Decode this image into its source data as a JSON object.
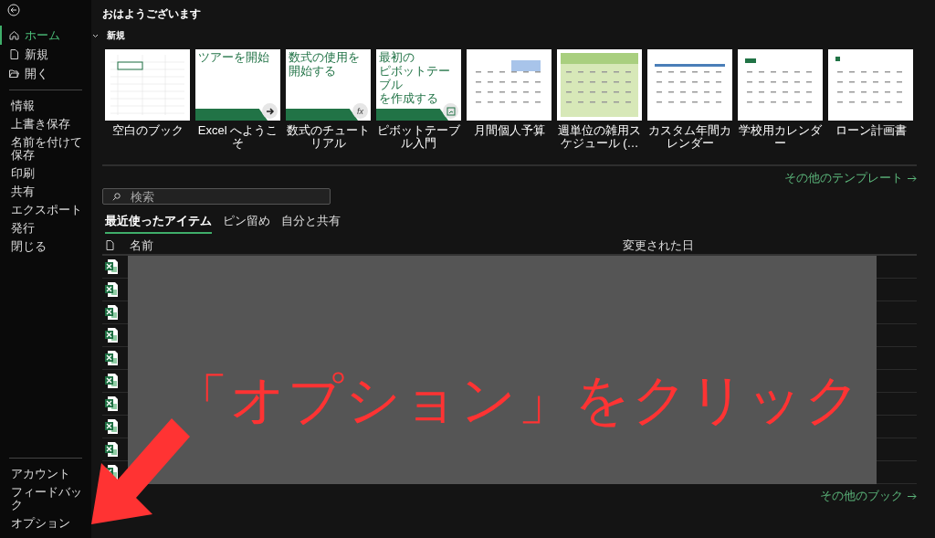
{
  "sidebar": {
    "primary_items": [
      {
        "label": "ホーム",
        "kind": "home",
        "selected": true
      },
      {
        "label": "新規",
        "kind": "new",
        "selected": false
      },
      {
        "label": "開く",
        "kind": "open",
        "selected": false
      }
    ],
    "items": [
      "情報",
      "上書き保存",
      "名前を付けて保存",
      "印刷",
      "共有",
      "エクスポート",
      "発行",
      "閉じる"
    ],
    "bottom_items": [
      "アカウント",
      "フィードバック",
      "オプション"
    ]
  },
  "greeting": "おはようございます",
  "new_section": {
    "title": "新規",
    "expanded": true,
    "templates": [
      {
        "kind": "blank",
        "label": "空白のブック"
      },
      {
        "kind": "tour",
        "label": "Excel へようこそ",
        "lines": [
          "ツアーを開始"
        ]
      },
      {
        "kind": "formula",
        "label": "数式のチュートリアル",
        "lines": [
          "数式の使用を",
          "開始する"
        ],
        "badge": "fx"
      },
      {
        "kind": "pivot",
        "label": "ピボットテーブル入門",
        "lines": [
          "最初の",
          "ピボットテーブル",
          "を作成する"
        ]
      },
      {
        "kind": "budget",
        "label": "月間個人予算"
      },
      {
        "kind": "schedule",
        "label": "週単位の雑用スケジュール (…"
      },
      {
        "kind": "calendar",
        "label": "カスタム年間カレンダー"
      },
      {
        "kind": "school",
        "label": "学校用カレンダー"
      },
      {
        "kind": "loan",
        "label": "ローン計画書"
      }
    ],
    "more_link": "その他のテンプレート"
  },
  "search": {
    "placeholder": "検索"
  },
  "tabs": [
    {
      "label": "最近使ったアイテム",
      "selected": true
    },
    {
      "label": "ピン留め",
      "selected": false
    },
    {
      "label": "自分と共有",
      "selected": false
    }
  ],
  "table": {
    "columns": [
      "名前",
      "変更された日"
    ],
    "rows": [
      {
        "kind": "excel"
      },
      {
        "kind": "excel"
      },
      {
        "kind": "excel"
      },
      {
        "kind": "excel"
      },
      {
        "kind": "excel"
      },
      {
        "kind": "excel"
      },
      {
        "kind": "excel"
      },
      {
        "kind": "excel"
      },
      {
        "kind": "excel"
      },
      {
        "kind": "excel"
      }
    ]
  },
  "more_books_link": "その他のブック",
  "annotation": {
    "text": "「オプション」をクリック"
  }
}
